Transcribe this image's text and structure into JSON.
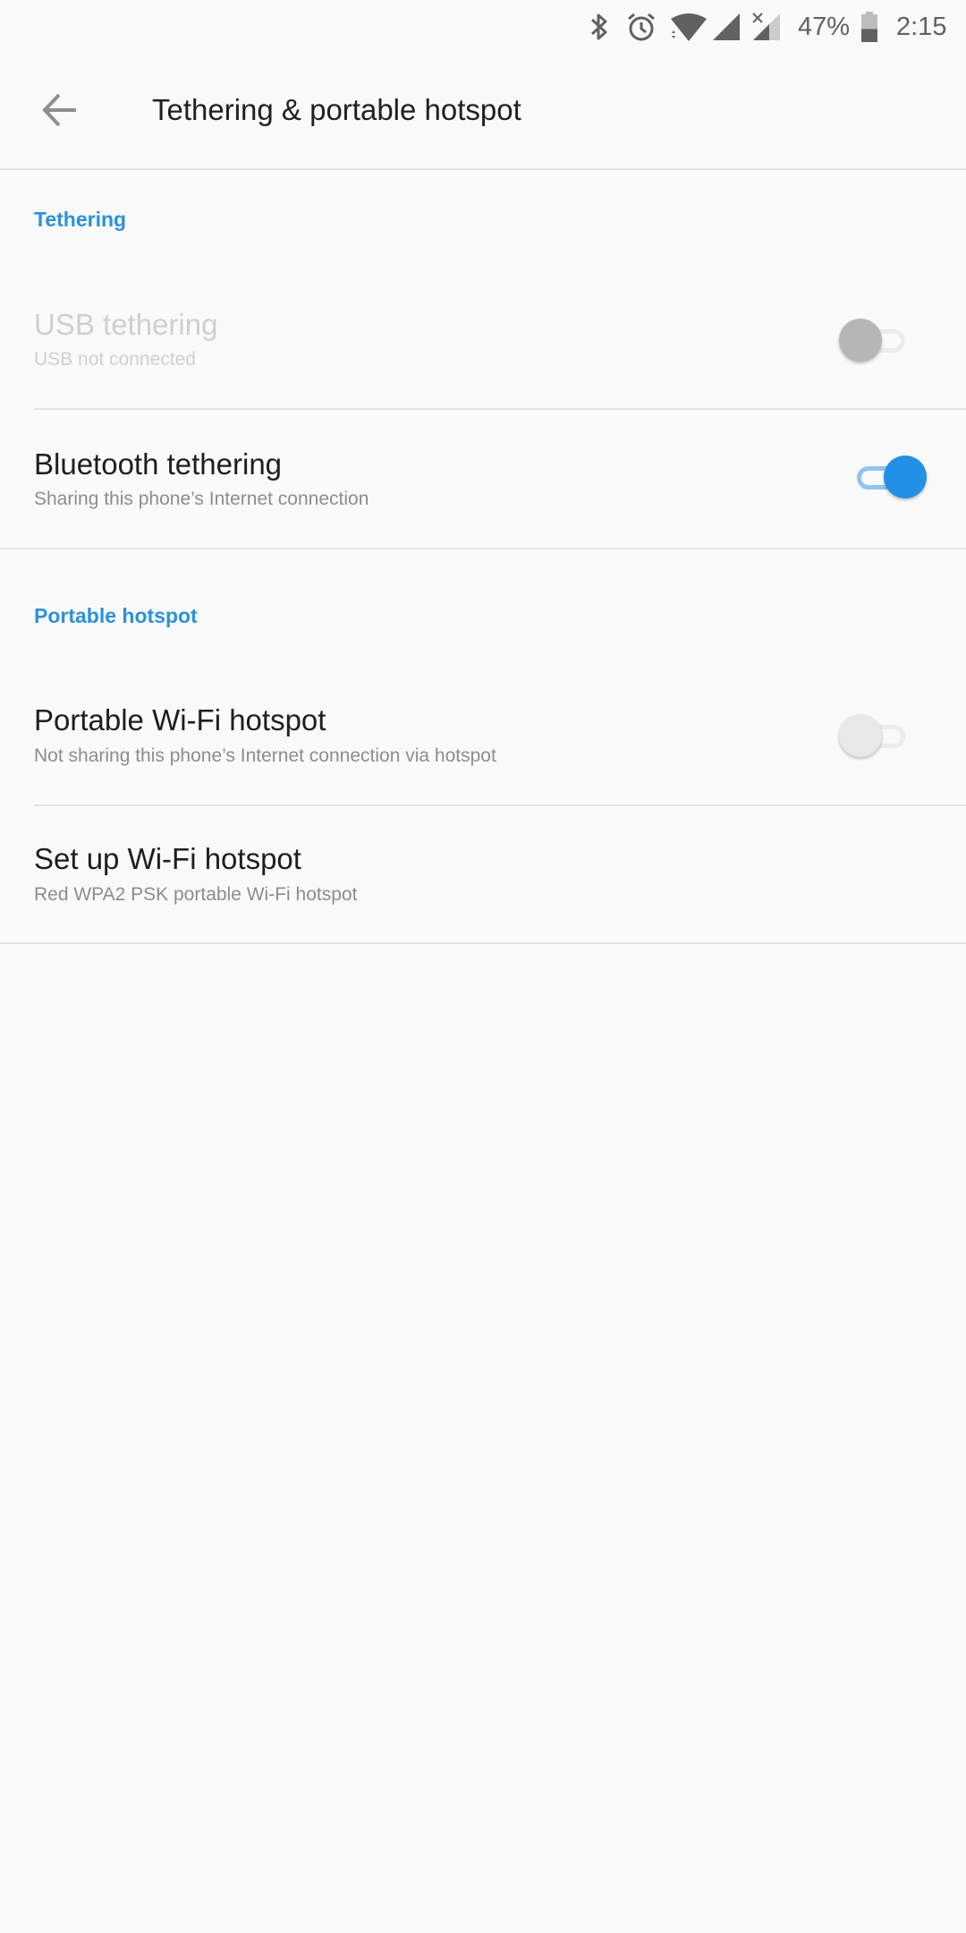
{
  "status_bar": {
    "icons": [
      "bluetooth-icon",
      "alarm-icon",
      "wifi-icon",
      "cell-signal-icon",
      "cell-signal-no-data-icon",
      "battery-icon"
    ],
    "battery_percent": "47%",
    "battery_level": 0.47,
    "time": "2:15"
  },
  "toolbar": {
    "back_icon": "arrow-left-icon",
    "title": "Tethering & portable hotspot"
  },
  "sections": [
    {
      "header": "Tethering",
      "items": [
        {
          "title": "USB tethering",
          "subtitle": "USB not connected",
          "toggle": false,
          "enabled": false
        },
        {
          "title": "Bluetooth tethering",
          "subtitle": "Sharing this phone’s Internet connection",
          "toggle": true,
          "enabled": true
        }
      ]
    },
    {
      "header": "Portable hotspot",
      "items": [
        {
          "title": "Portable Wi-Fi hotspot",
          "subtitle": "Not sharing this phone’s Internet connection via hotspot",
          "toggle": false,
          "enabled": true
        },
        {
          "title": "Set up Wi-Fi hotspot",
          "subtitle": "Red WPA2 PSK portable Wi-Fi hotspot",
          "enabled": true
        }
      ]
    }
  ],
  "colors": {
    "accent": "#2b91de",
    "switch_on": "#2390e8",
    "switch_on_track": "#92c4f0",
    "background": "#fafafa"
  }
}
